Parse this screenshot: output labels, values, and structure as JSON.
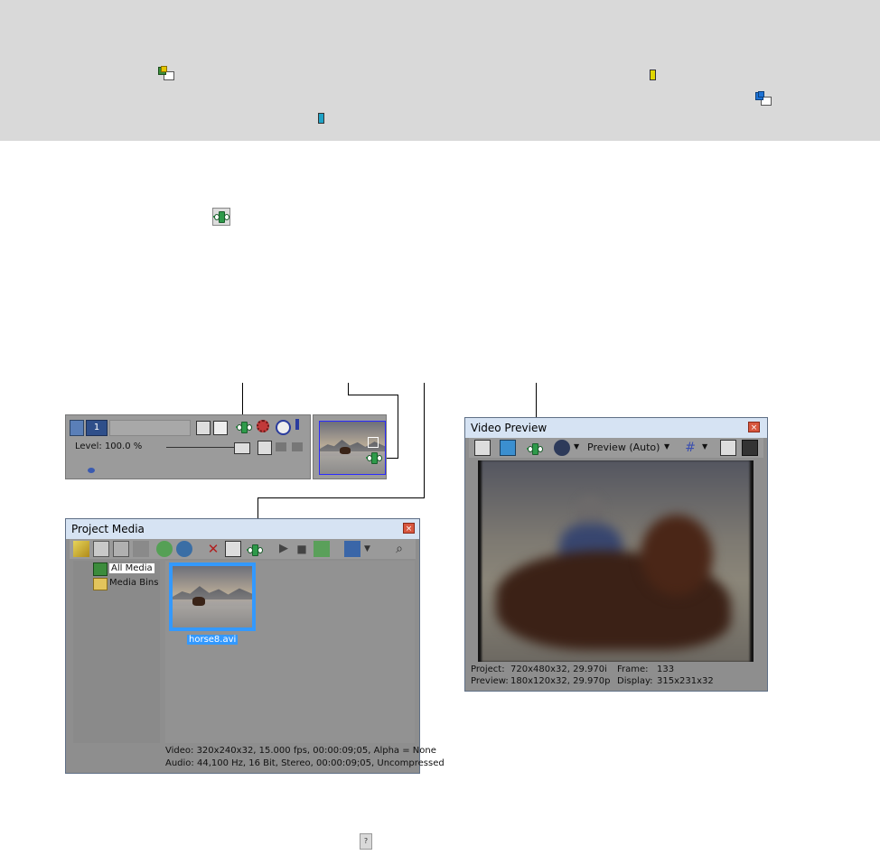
{
  "preview_panel": {
    "level_label": "Level: 100.0 %",
    "spin_value": "1"
  },
  "project_media": {
    "title": "Project Media",
    "tree": [
      "All Media",
      "Media Bins"
    ],
    "clip_name": "horse8.avi",
    "status_video": "Video: 320x240x32, 15.000 fps, 00:00:09;05, Alpha = None",
    "status_audio": "Audio: 44,100 Hz, 16 Bit, Stereo, 00:00:09;05, Uncompressed"
  },
  "video_preview": {
    "title": "Video Preview",
    "mode": "Preview (Auto)",
    "project_label": "Project:",
    "project_value": "720x480x32, 29.970i",
    "frame_label": "Frame:",
    "frame_value": "133",
    "preview_label": "Preview:",
    "preview_value": "180x120x32, 29.970p",
    "display_label": "Display:",
    "display_value": "315x231x32"
  },
  "icons": {
    "band_icons": [
      "event-fx-icon",
      "yellow-bar-icon",
      "blue-fx-icon",
      "cyan-bar-icon"
    ],
    "fx_chain": "video-fx-chain-icon",
    "help": "help-icon"
  },
  "colors": {
    "band_bg": "#d9d9d9",
    "fx_green": "#2e9a4a",
    "title_bar": "#d6e3f3",
    "selection": "#3399ff"
  },
  "footer": {
    "help_glyph": "?"
  }
}
